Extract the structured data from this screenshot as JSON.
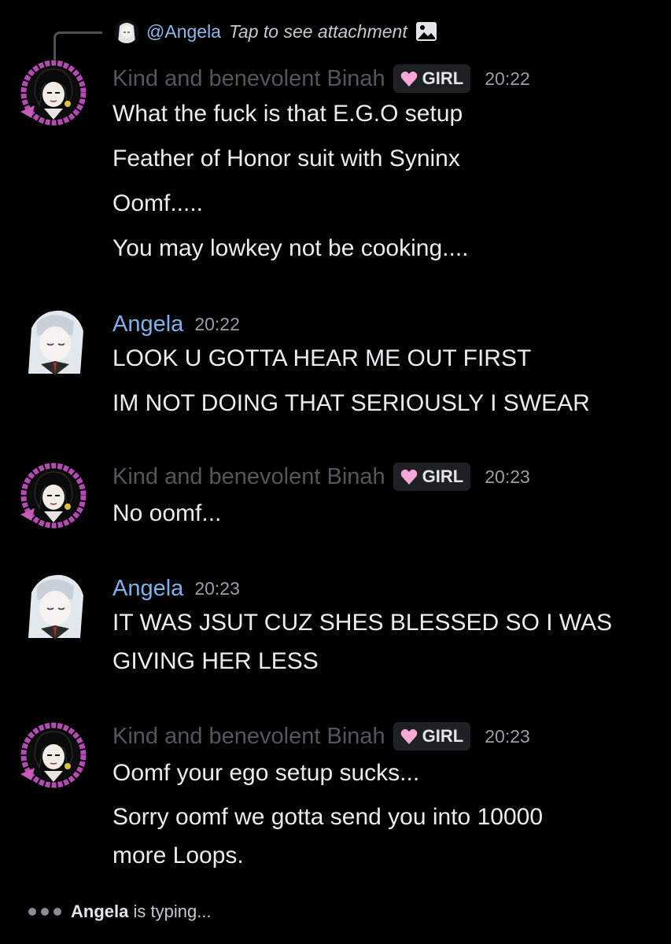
{
  "reply": {
    "name": "@Angela",
    "text": "Tap to see attachment"
  },
  "messages": [
    {
      "author": "Kind and benevolent Binah",
      "badge": "GIRL",
      "time": "20:22",
      "lines": [
        "What the fuck is that E.G.O setup",
        "Feather of Honor suit with Syninx",
        "Oomf.....",
        "You may lowkey not be cooking...."
      ]
    },
    {
      "author": "Angela",
      "time": "20:22",
      "lines": [
        "LOOK U GOTTA HEAR ME OUT FIRST",
        "IM NOT DOING THAT SERIOUSLY I SWEAR"
      ]
    },
    {
      "author": "Kind and benevolent Binah",
      "badge": "GIRL",
      "time": "20:23",
      "lines": [
        "No oomf..."
      ]
    },
    {
      "author": "Angela",
      "time": "20:23",
      "lines": [
        "IT WAS JSUT CUZ SHES BLESSED SO I WAS",
        "GIVING HER LESS"
      ]
    },
    {
      "author": "Kind and benevolent Binah",
      "badge": "GIRL",
      "time": "20:23",
      "lines": [
        "Oomf your ego setup sucks...",
        "Sorry oomf we gotta send you into 10000",
        "more Loops."
      ]
    }
  ],
  "typing": {
    "user": "Angela",
    "text": "is typing..."
  },
  "colors": {
    "background": "#000000",
    "binah_name": "#54565d",
    "angela_name": "#7fb1ea",
    "avatar_frame": "#b44bb3"
  }
}
